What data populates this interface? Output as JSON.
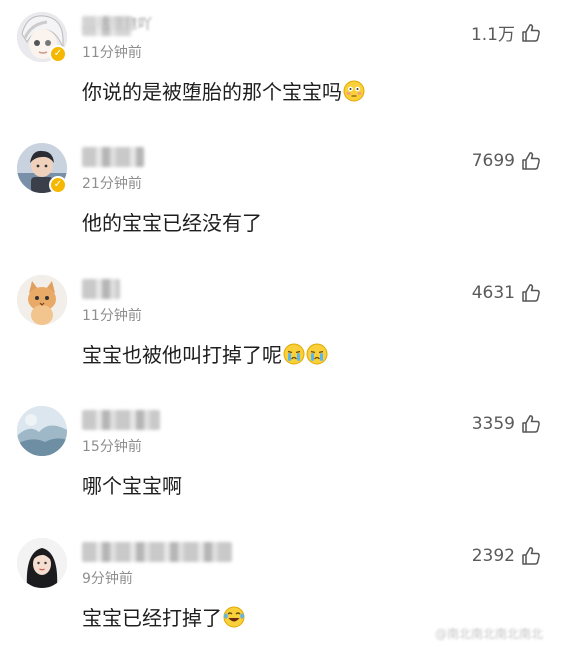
{
  "comments": [
    {
      "avatar_icon": "anime-avatar",
      "username_visible": "…枯意意吖",
      "time": "11分钟前",
      "text": "你说的是被堕胎的那个宝宝吗",
      "emoji_icon": "flushed-face-emoji",
      "likes": "1.1万",
      "verified": true
    },
    {
      "avatar_icon": "child-avatar",
      "time": "21分钟前",
      "text": "他的宝宝已经没有了",
      "likes": "7699",
      "verified": true
    },
    {
      "avatar_icon": "cat-avatar",
      "time": "11分钟前",
      "text": "宝宝也被他叫打掉了呢",
      "emoji_icon": "crying-face-emoji",
      "likes": "4631",
      "verified": false
    },
    {
      "avatar_icon": "landscape-avatar",
      "time": "15分钟前",
      "text": "哪个宝宝啊",
      "likes": "3359",
      "verified": false
    },
    {
      "avatar_icon": "girl-avatar",
      "time": "9分钟前",
      "text": "宝宝已经打掉了",
      "emoji_icon": "laughing-tears-emoji",
      "likes": "2392",
      "verified": false
    }
  ],
  "watermark": "@南北南北南北南北",
  "colors": {
    "time": "#8f8f8f",
    "likes": "#5a5a5a",
    "verified_badge": "#f6b700",
    "text": "#1e1e1e"
  }
}
